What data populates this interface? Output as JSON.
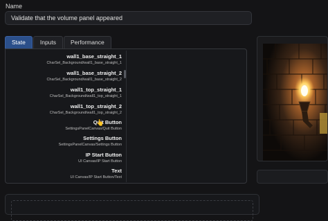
{
  "name_field": {
    "label": "Name",
    "value": "Validate that the volume panel appeared"
  },
  "tabs": [
    {
      "label": "State",
      "active": true
    },
    {
      "label": "Inputs",
      "active": false
    },
    {
      "label": "Performance",
      "active": false
    }
  ],
  "hierarchy": {
    "items": [
      {
        "title": "wall1_base_straight_1",
        "path": "CharSel_Background/wall1_base_straight_1"
      },
      {
        "title": "wall1_base_straight_2",
        "path": "CharSel_Background/wall1_base_straight_2"
      },
      {
        "title": "wall1_top_straight_1",
        "path": "CharSel_Background/wall1_top_straight_1"
      },
      {
        "title": "wall1_top_straight_2",
        "path": "CharSel_Background/wall1_top_straight_2"
      },
      {
        "title": "Quit Button",
        "path": "SettingsPanelCanvas/Quit Button"
      },
      {
        "title": "Settings Button",
        "path": "SettingsPanelCanvas/Settings Button"
      },
      {
        "title": "IP Start Button",
        "path": "UI Canvas/IP Start Button"
      },
      {
        "title": "Text",
        "path": "UI Canvas/IP Start Button/Text"
      }
    ]
  },
  "preview": {
    "icon": "game-screenshot-torch-on-brick-wall"
  }
}
